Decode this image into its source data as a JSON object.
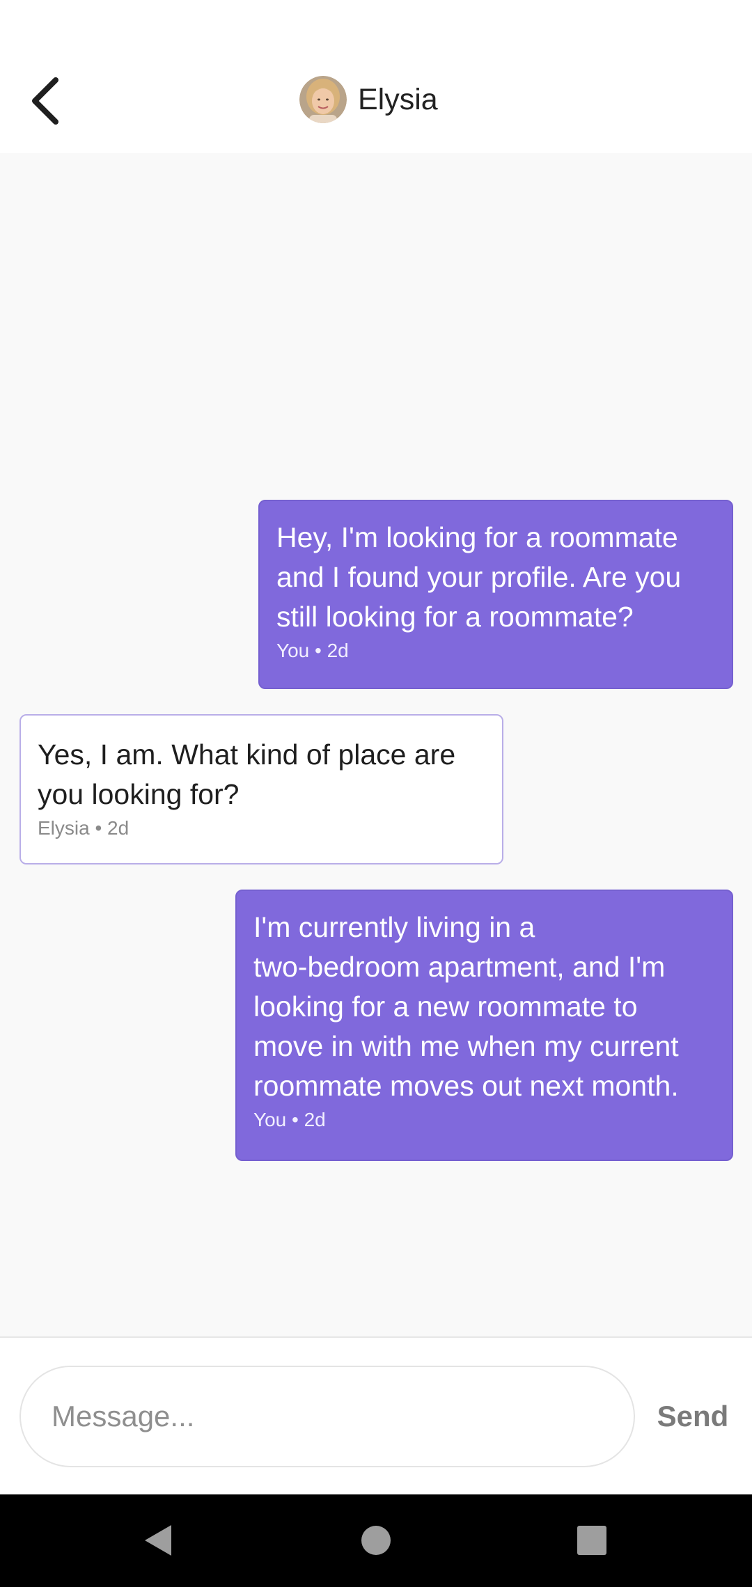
{
  "header": {
    "contact_name": "Elysia",
    "back_icon": "chevron-left-icon",
    "avatar_icon": "avatar-photo"
  },
  "messages": [
    {
      "direction": "sent",
      "text": "Hey, I'm looking for a roommate\nand I found your profile. Are you\nstill looking for a roommate?",
      "meta": "You • 2d"
    },
    {
      "direction": "received",
      "text": "Yes, I am. What kind of place are\nyou looking for?",
      "meta": "Elysia  • 2d"
    },
    {
      "direction": "sent",
      "text": "I'm currently living in a\ntwo-bedroom apartment, and I'm\nlooking for a new roommate to\nmove in with me when my current\nroommate moves out next month.",
      "meta": "You • 2d"
    }
  ],
  "composer": {
    "placeholder": "Message...",
    "value": "",
    "send_label": "Send"
  },
  "nav_bar": {
    "back_icon": "triangle-back-icon",
    "home_icon": "circle-home-icon",
    "recents_icon": "square-recents-icon"
  },
  "colors": {
    "sent_bubble": "#8069dc",
    "received_border": "#b9aee8",
    "background": "#f9f9f9"
  }
}
